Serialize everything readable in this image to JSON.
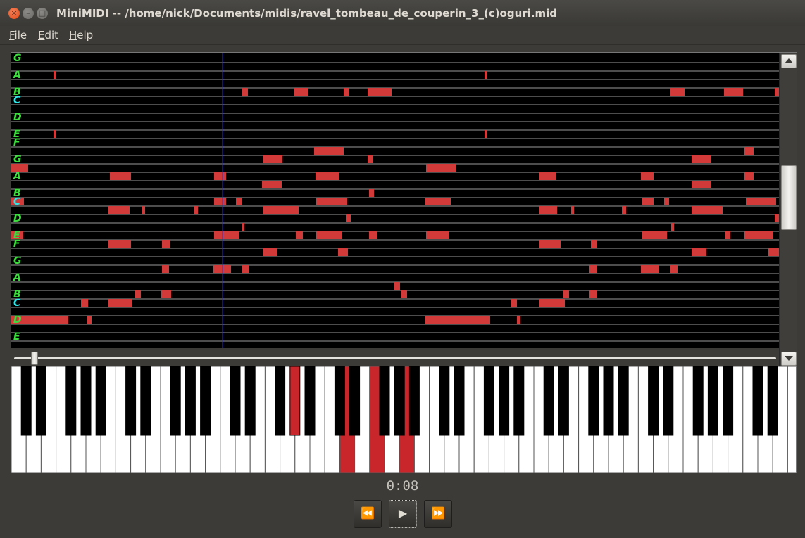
{
  "window": {
    "title": "MiniMIDI -- /home/nick/Documents/midis/ravel_tombeau_de_couperin_3_(c)oguri.mid",
    "close_icon": "×",
    "minimize_icon": "–",
    "maximize_icon": "□"
  },
  "menu": {
    "file": "File",
    "edit": "Edit",
    "help": "Help"
  },
  "pianoroll": {
    "note_color": "#d23a3a",
    "label_colors": {
      "natural": "#3fdc3f",
      "c": "#2fe8e8"
    },
    "labels": [
      {
        "t": "G",
        "row": 0
      },
      {
        "t": "A",
        "row": 2
      },
      {
        "t": "B",
        "row": 4
      },
      {
        "t": "C",
        "row": 5,
        "c": true
      },
      {
        "t": "D",
        "row": 7
      },
      {
        "t": "E",
        "row": 9
      },
      {
        "t": "F",
        "row": 10
      },
      {
        "t": "G",
        "row": 12
      },
      {
        "t": "A",
        "row": 14
      },
      {
        "t": "B",
        "row": 16
      },
      {
        "t": "C",
        "row": 17,
        "c": true
      },
      {
        "t": "D",
        "row": 19
      },
      {
        "t": "E",
        "row": 21
      },
      {
        "t": "F",
        "row": 22
      },
      {
        "t": "G",
        "row": 24
      },
      {
        "t": "A",
        "row": 26
      },
      {
        "t": "B",
        "row": 28
      },
      {
        "t": "C",
        "row": 29,
        "c": true
      },
      {
        "t": "D",
        "row": 31
      },
      {
        "t": "E",
        "row": 33
      }
    ],
    "notes": [
      [
        2,
        60,
        64
      ],
      [
        2,
        672,
        676
      ],
      [
        4,
        328,
        336
      ],
      [
        4,
        402,
        422
      ],
      [
        4,
        472,
        480
      ],
      [
        4,
        506,
        540
      ],
      [
        4,
        936,
        956
      ],
      [
        4,
        1012,
        1039
      ],
      [
        4,
        1084,
        1090
      ],
      [
        9,
        60,
        64
      ],
      [
        9,
        672,
        675
      ],
      [
        11,
        430,
        472
      ],
      [
        11,
        1041,
        1054
      ],
      [
        12,
        358,
        385
      ],
      [
        12,
        506,
        513
      ],
      [
        12,
        966,
        993
      ],
      [
        13,
        0,
        24
      ],
      [
        13,
        589,
        631
      ],
      [
        14,
        140,
        170
      ],
      [
        14,
        288,
        305
      ],
      [
        14,
        432,
        466
      ],
      [
        14,
        750,
        774
      ],
      [
        14,
        894,
        912
      ],
      [
        14,
        1041,
        1054
      ],
      [
        15,
        356,
        384
      ],
      [
        15,
        966,
        993
      ],
      [
        16,
        508,
        515
      ],
      [
        17,
        0,
        18
      ],
      [
        17,
        288,
        305
      ],
      [
        17,
        319,
        328
      ],
      [
        17,
        433,
        477
      ],
      [
        17,
        587,
        624
      ],
      [
        17,
        895,
        912
      ],
      [
        17,
        927,
        934
      ],
      [
        17,
        1043,
        1086
      ],
      [
        18,
        138,
        168
      ],
      [
        18,
        185,
        190
      ],
      [
        18,
        260,
        265
      ],
      [
        18,
        358,
        408
      ],
      [
        18,
        749,
        775
      ],
      [
        18,
        795,
        799
      ],
      [
        18,
        867,
        873
      ],
      [
        18,
        966,
        1010
      ],
      [
        19,
        475,
        482
      ],
      [
        19,
        1084,
        1090
      ],
      [
        20,
        328,
        331
      ],
      [
        20,
        937,
        941
      ],
      [
        21,
        0,
        17
      ],
      [
        21,
        288,
        324
      ],
      [
        21,
        404,
        414
      ],
      [
        21,
        433,
        470
      ],
      [
        21,
        508,
        519
      ],
      [
        21,
        589,
        622
      ],
      [
        21,
        895,
        931
      ],
      [
        21,
        1013,
        1021
      ],
      [
        21,
        1041,
        1082
      ],
      [
        22,
        138,
        170
      ],
      [
        22,
        214,
        226
      ],
      [
        22,
        749,
        780
      ],
      [
        22,
        823,
        832
      ],
      [
        23,
        357,
        378
      ],
      [
        23,
        464,
        478
      ],
      [
        23,
        966,
        987
      ],
      [
        23,
        1075,
        1090
      ],
      [
        25,
        214,
        224
      ],
      [
        25,
        287,
        312
      ],
      [
        25,
        327,
        337
      ],
      [
        25,
        821,
        831
      ],
      [
        25,
        894,
        919
      ],
      [
        25,
        935,
        946
      ],
      [
        27,
        544,
        552
      ],
      [
        28,
        175,
        184
      ],
      [
        28,
        213,
        227
      ],
      [
        28,
        554,
        562
      ],
      [
        28,
        784,
        792
      ],
      [
        28,
        821,
        832
      ],
      [
        29,
        99,
        109
      ],
      [
        29,
        138,
        172
      ],
      [
        29,
        709,
        718
      ],
      [
        29,
        749,
        786
      ],
      [
        31,
        0,
        81
      ],
      [
        31,
        108,
        114
      ],
      [
        31,
        587,
        680
      ],
      [
        31,
        718,
        723
      ]
    ],
    "playhead_time": "0:08"
  },
  "scroll": {
    "up_icon": "triangle-up-icon",
    "down_icon": "triangle-down-icon"
  },
  "keyboard": {
    "pressed_color": "#c8262a",
    "pressed_white": [
      22,
      24,
      26
    ],
    "pressed_black": [
      13
    ]
  },
  "transport": {
    "time": "0:08",
    "rewind_label": "⏪",
    "play_label": "▶",
    "forward_label": "⏩"
  }
}
